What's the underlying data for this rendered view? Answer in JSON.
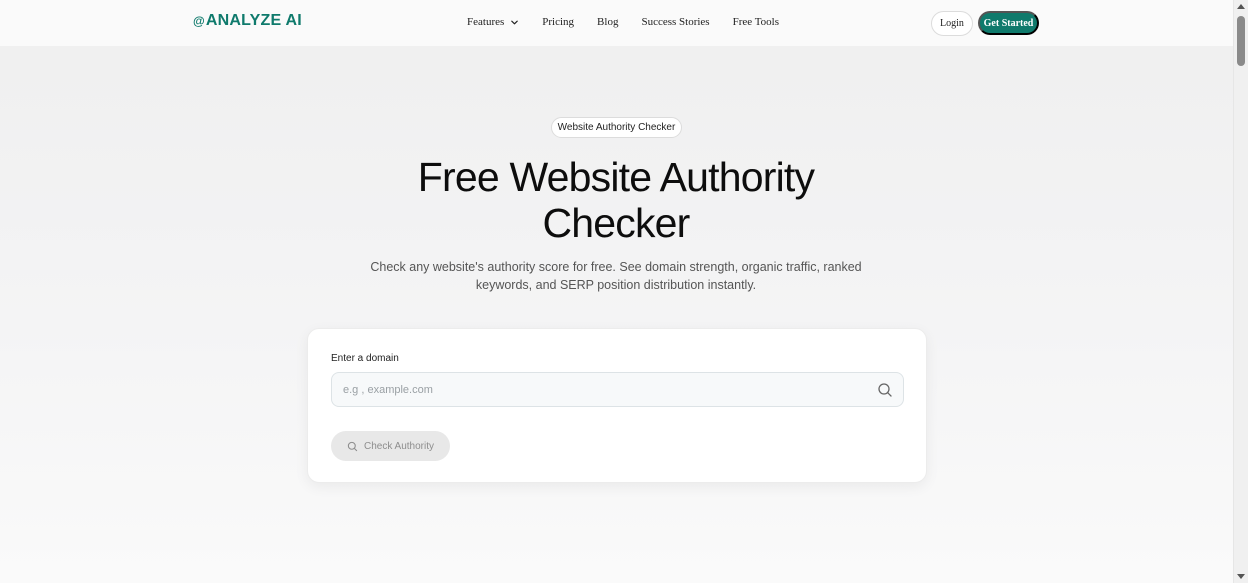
{
  "header": {
    "logo_mark": "@",
    "logo_text": "ANALYZE AI",
    "nav": [
      {
        "label": "Features"
      },
      {
        "label": "Pricing"
      },
      {
        "label": "Blog"
      },
      {
        "label": "Success Stories"
      },
      {
        "label": "Free Tools"
      }
    ],
    "login_label": "Login",
    "get_started_label": "Get Started"
  },
  "hero": {
    "badge": "Website Authority Checker",
    "title_line1": "Free Website Authority",
    "title_line2": "Checker",
    "subtitle_line1": "Check any website's authority score for free. See domain strength, organic traffic, ranked",
    "subtitle_line2": "keywords, and SERP position distribution instantly."
  },
  "form": {
    "label": "Enter a domain",
    "input_value": "",
    "placeholder": "e.g , example.com",
    "button_label": "Check Authority"
  },
  "icons": {
    "features_dropdown": "chevron-down-icon",
    "input": "search-icon",
    "button": "search-icon"
  },
  "colors": {
    "brand": "#0f7a6c",
    "button_disabled_bg": "#e8e8e8",
    "button_disabled_text": "#8e8e8e"
  }
}
